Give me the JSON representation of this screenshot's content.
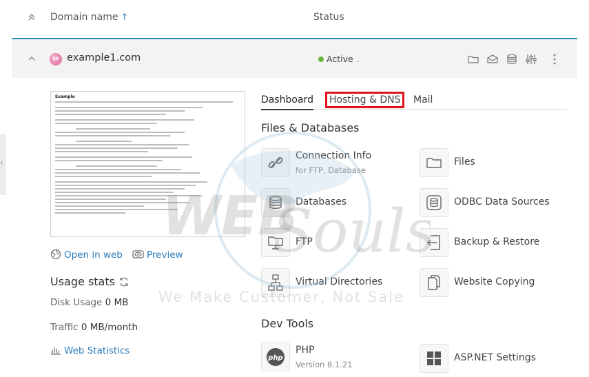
{
  "header": {
    "domain_col": "Domain name",
    "sort_arrow": "↑",
    "status_col": "Status"
  },
  "side_strip": {
    "glyph": "‹"
  },
  "domain": {
    "name": "example1.com",
    "icon_text": "EX",
    "status": "Active",
    "status_color": "#6db33f"
  },
  "preview": {
    "title": "Example",
    "open_in_web": "Open in web",
    "preview_label": "Preview"
  },
  "usage": {
    "title": "Usage stats",
    "disk_label": "Disk Usage",
    "disk_value": "0 MB",
    "traffic_label": "Traffic",
    "traffic_value": "0 MB/month",
    "web_statistics": "Web Statistics"
  },
  "tabs": [
    {
      "label": "Dashboard"
    },
    {
      "label": "Hosting & DNS"
    },
    {
      "label": "Mail"
    }
  ],
  "sections": {
    "files_db": "Files & Databases",
    "dev_tools": "Dev Tools"
  },
  "tiles": {
    "connection_info": {
      "label": "Connection Info",
      "sub": "for FTP, Database"
    },
    "files": {
      "label": "Files"
    },
    "databases": {
      "label": "Databases"
    },
    "odbc": {
      "label": "ODBC Data Sources"
    },
    "ftp": {
      "label": "FTP"
    },
    "backup": {
      "label": "Backup & Restore"
    },
    "virtual_dirs": {
      "label": "Virtual Directories"
    },
    "website_copying": {
      "label": "Website Copying"
    },
    "php": {
      "label": "PHP",
      "sub": "Version 8.1.21"
    },
    "aspnet": {
      "label": "ASP.NET Settings"
    }
  },
  "watermark": {
    "brand_top": "WEB",
    "brand_script": "Souls",
    "tagline": "We Make Customer, Not Sale"
  },
  "colors": {
    "accent": "#2b7bb9",
    "card_border": "#2c8fbf",
    "highlight": "#e0121b"
  }
}
